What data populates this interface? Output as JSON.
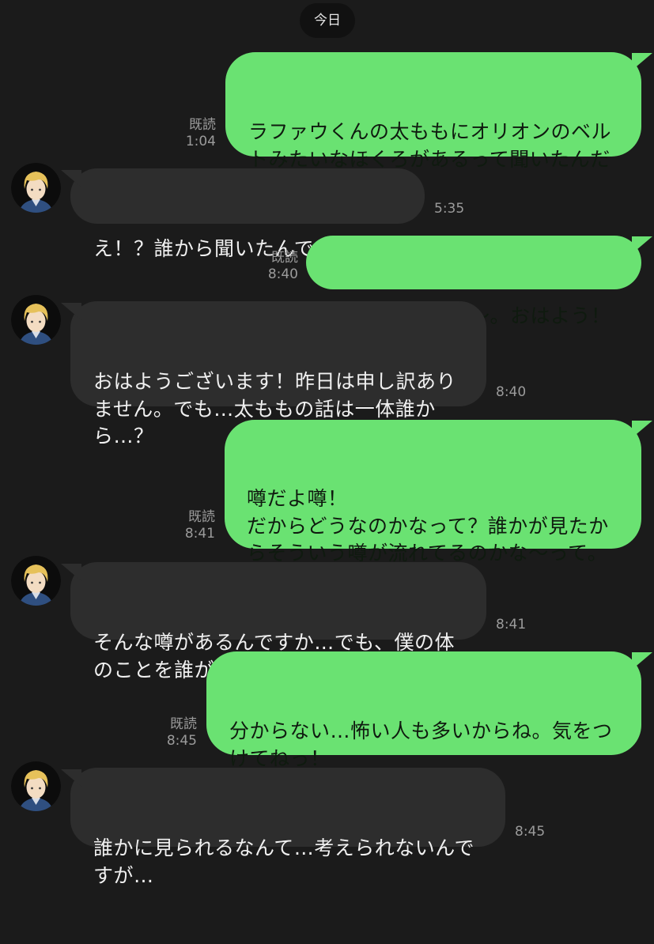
{
  "date_label": "今日",
  "read_label": "既読",
  "colors": {
    "sent_bubble": "#6ae272",
    "received_bubble": "#2d2d2d",
    "background": "#1b1b1b"
  },
  "avatar_icon": "blond-boy-avatar-icon",
  "messages": [
    {
      "dir": "sent",
      "text": "ラファウくんの太ももにオリオンのベル\nトみたいなほくろがあるって聞いたんだ\nけどある？",
      "time": "1:04",
      "read": true
    },
    {
      "dir": "received",
      "text": "え！？誰から聞いたんですか！？",
      "time": "5:35"
    },
    {
      "dir": "sent",
      "text": "深夜にごめんね〜。おはよう！",
      "time": "8:40",
      "read": true
    },
    {
      "dir": "received",
      "text": "おはようございます！昨日は申し訳あり\nません。でも…太ももの話は一体誰か\nら…？",
      "time": "8:40"
    },
    {
      "dir": "sent",
      "text": "噂だよ噂！\nだからどうなのかなって？誰かが見たか\nらそういう噂が流れてるのかな〜って。\nある？",
      "time": "8:41",
      "read": true
    },
    {
      "dir": "received",
      "text": "そんな噂があるんですか…でも、僕の体\nのことを誰が…？",
      "time": "8:41"
    },
    {
      "dir": "sent",
      "text": "分からない…怖い人も多いからね。気をつ\nけてねっ！\nいつ見られたかとか検討つく？",
      "time": "8:45",
      "read": true
    },
    {
      "dir": "received",
      "text": "誰かに見られるなんて…考えられないんで\nすが…",
      "time": "8:45"
    }
  ]
}
